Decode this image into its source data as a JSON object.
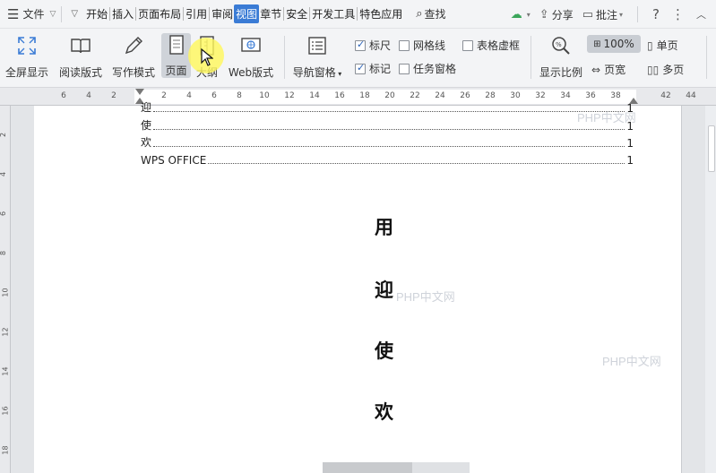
{
  "menubar": {
    "file_label": "文件",
    "tabs": [
      "开始",
      "插入",
      "页面布局",
      "引用",
      "审阅",
      "视图",
      "章节",
      "安全",
      "开发工具",
      "特色应用"
    ],
    "active_tab": "视图",
    "search_label": "查找",
    "share_label": "分享",
    "comment_label": "批注",
    "help_icon": "question-icon",
    "more_icon": "more-icon",
    "close_label": "✕"
  },
  "ribbon": {
    "fullscreen_label": "全屏显示",
    "reading_label": "阅读版式",
    "writing_label": "写作模式",
    "page_label": "页面",
    "outline_label": "大纲",
    "web_label": "Web版式",
    "nav_pane_label": "导航窗格",
    "ruler_label": "标尺",
    "gridline_label": "网格线",
    "table_dashed_label": "表格虚框",
    "mark_label": "标记",
    "task_pane_label": "任务窗格",
    "zoom_label": "显示比例",
    "zoom_value": "100%",
    "page_width_label": "页宽",
    "single_page_label": "单页",
    "multi_page_label": "多页"
  },
  "ruler": {
    "ticks": [
      "6",
      "4",
      "2",
      "",
      "2",
      "4",
      "6",
      "8",
      "10",
      "12",
      "14",
      "16",
      "18",
      "20",
      "22",
      "24",
      "26",
      "28",
      "30",
      "32",
      "34",
      "36",
      "38",
      "",
      "42",
      "44"
    ],
    "vticks": [
      "2",
      "4",
      "6",
      "8",
      "10",
      "12",
      "14",
      "16",
      "18"
    ]
  },
  "document": {
    "toc": [
      {
        "text": "迎",
        "page": "1"
      },
      {
        "text": "使",
        "page": "1"
      },
      {
        "text": "欢",
        "page": "1"
      },
      {
        "text": "WPS OFFICE",
        "page": "1"
      }
    ],
    "chars": [
      "用",
      "迎",
      "使",
      "欢"
    ],
    "watermark": "PHP中文网"
  },
  "colors": {
    "accent": "#3a7bd5",
    "highlight": "#fff75a"
  }
}
